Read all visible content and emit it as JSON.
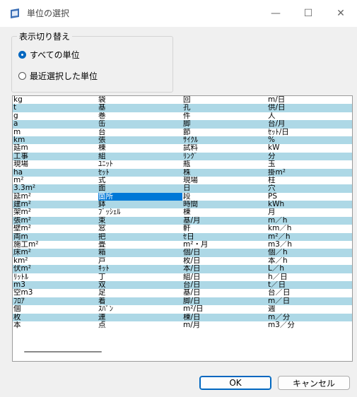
{
  "window": {
    "title": "単位の選択",
    "minimize": "—",
    "maximize": "☐",
    "close": "✕"
  },
  "group": {
    "legend": "表示切り替え",
    "options": [
      {
        "label": "すべての単位",
        "selected": true
      },
      {
        "label": "最近選択した単位",
        "selected": false
      }
    ]
  },
  "units": {
    "columns": [
      [
        "kg",
        "t",
        "g",
        "a",
        "m",
        "km",
        "延m",
        "工事",
        "現場",
        "ha",
        "m²",
        "3.3m²",
        "延m²",
        "建m²",
        "架m²",
        "張m²",
        "壁m²",
        "両m",
        "施工m²",
        "床m²",
        "km²",
        "伏m²",
        "ﾘｯﾄﾙ",
        "m3",
        "空m3",
        "ﾌﾛｱ",
        "個",
        "枚",
        "本"
      ],
      [
        "袋",
        "基",
        "巻",
        "缶",
        "台",
        "張",
        "棟",
        "組",
        "ﾕﾆｯﾄ",
        "ｾｯﾄ",
        "式",
        "面",
        "箇所",
        "鉢",
        "ﾌﾞｯｼｪﾙ",
        "束",
        "窓",
        "把",
        "畳",
        "箱",
        "戸",
        "ｷｯﾄ",
        "丁",
        "双",
        "足",
        "着",
        "ｽﾊﾟﾝ",
        "連",
        "点"
      ],
      [
        "回",
        "孔",
        "件",
        "脚",
        "節",
        "ｻｲｸﾙ",
        "試料",
        "ﾘﾝｸﾞ",
        "瓶",
        "株",
        "現場",
        "日",
        "段",
        "時間",
        "棟",
        "基/月",
        "軒",
        "ｾ日",
        "m²・月",
        "個/日",
        "枚/日",
        "本/日",
        "組/日",
        "台/日",
        "基/日",
        "脚/日",
        "m²/日",
        "棟/日",
        "m/月"
      ],
      [
        "m/日",
        "供/日",
        "人",
        "台/月",
        "ｾｯﾄ/日",
        "%",
        "kW",
        "分",
        "玉",
        "掛m²",
        "柱",
        "穴",
        "PS",
        "kWh",
        "月",
        "m／h",
        "km／h",
        "m²／h",
        "m3／h",
        "個／h",
        "本／h",
        "L／h",
        "h／日",
        "t／日",
        "台／日",
        "m／日",
        "週",
        "m／分",
        "m3／分"
      ]
    ],
    "selected": {
      "column": 1,
      "row": 12
    }
  },
  "buttons": {
    "ok": "OK",
    "cancel": "キャンセル"
  }
}
